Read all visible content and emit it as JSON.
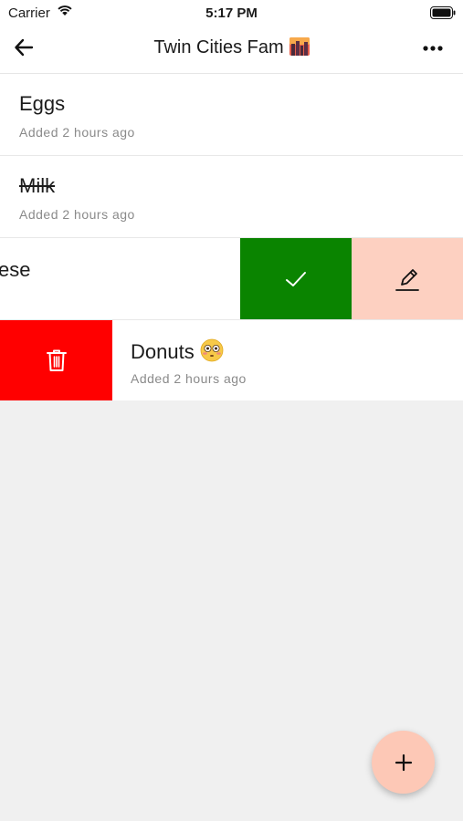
{
  "status_bar": {
    "carrier": "Carrier",
    "time": "5:17 PM"
  },
  "header": {
    "title": "Twin Cities Fam",
    "back_icon": "arrow-left-icon",
    "menu_icon": "more-horizontal-icon",
    "title_emoji": "city-sunset-emoji"
  },
  "list": {
    "items": [
      {
        "name": "Eggs",
        "subtitle": "Added 2 hours ago",
        "completed": false
      },
      {
        "name": "Milk",
        "subtitle": "Added 2 hours ago",
        "completed": true
      },
      {
        "name": "ese",
        "subtitle": "",
        "completed": false,
        "actions": [
          "check-icon",
          "pencil-icon"
        ]
      },
      {
        "name": "Donuts",
        "subtitle": "Added 2 hours ago",
        "completed": false,
        "emoji": "flushed-face-emoji",
        "actions": [
          "trash-icon"
        ]
      }
    ]
  },
  "colors": {
    "check_action": "#0a8400",
    "edit_action": "#fdd0c1",
    "delete_action": "#ff0000",
    "fab": "#fdc8b6",
    "background": "#f0f0f0"
  },
  "fab": {
    "icon": "plus-icon"
  }
}
